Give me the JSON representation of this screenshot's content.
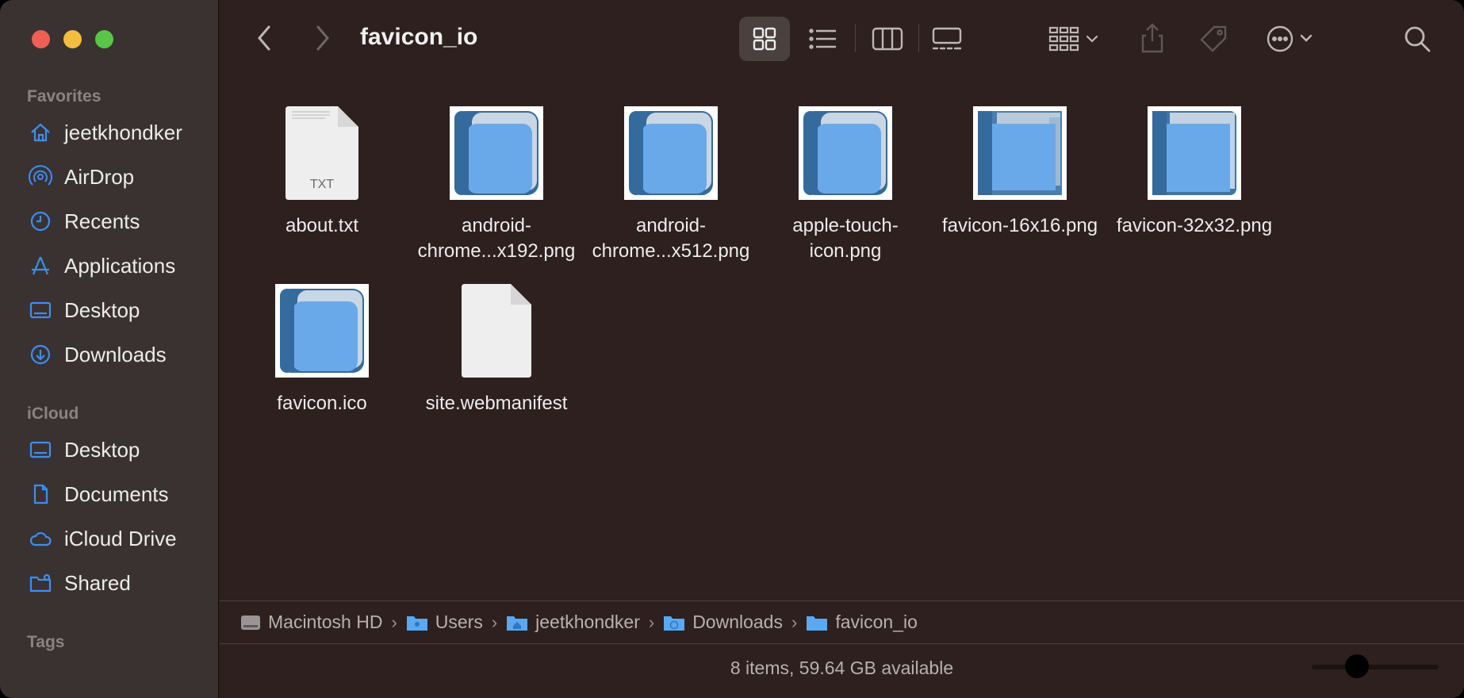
{
  "window": {
    "title": "favicon_io"
  },
  "toolbar": {
    "back_icon": "chevron-left",
    "forward_icon": "chevron-right",
    "views": [
      "icon-view",
      "list-view",
      "column-view",
      "gallery-view"
    ],
    "group_icon": "group-by",
    "share_icon": "share",
    "tag_icon": "tag",
    "more_icon": "ellipsis-circle",
    "search_icon": "magnifier"
  },
  "sidebar": {
    "favorites_title": "Favorites",
    "favorites": [
      {
        "label": "jeetkhondker",
        "icon": "home"
      },
      {
        "label": "AirDrop",
        "icon": "airdrop"
      },
      {
        "label": "Recents",
        "icon": "clock"
      },
      {
        "label": "Applications",
        "icon": "applications"
      },
      {
        "label": "Desktop",
        "icon": "desktop"
      },
      {
        "label": "Downloads",
        "icon": "download"
      }
    ],
    "icloud_title": "iCloud",
    "icloud": [
      {
        "label": "Desktop",
        "icon": "desktop"
      },
      {
        "label": "Documents",
        "icon": "document"
      },
      {
        "label": "iCloud Drive",
        "icon": "cloud"
      },
      {
        "label": "Shared",
        "icon": "shared-folder"
      }
    ],
    "tags_title": "Tags"
  },
  "files": [
    {
      "name": "about.txt",
      "kind": "txt",
      "badge": "TXT"
    },
    {
      "name": "android-chrome...x192.png",
      "kind": "png"
    },
    {
      "name": "android-chrome...x512.png",
      "kind": "png"
    },
    {
      "name": "apple-touch-icon.png",
      "kind": "png"
    },
    {
      "name": "favicon-16x16.png",
      "kind": "png"
    },
    {
      "name": "favicon-32x32.png",
      "kind": "png"
    },
    {
      "name": "favicon.ico",
      "kind": "png"
    },
    {
      "name": "site.webmanifest",
      "kind": "generic"
    }
  ],
  "pathbar": [
    {
      "label": "Macintosh HD",
      "icon": "disk"
    },
    {
      "label": "Users",
      "icon": "folder"
    },
    {
      "label": "jeetkhondker",
      "icon": "home-folder"
    },
    {
      "label": "Downloads",
      "icon": "download-folder"
    },
    {
      "label": "favicon_io",
      "icon": "folder"
    }
  ],
  "status": {
    "text": "8 items, 59.64 GB available"
  },
  "colors": {
    "accent": "#3b8ef6",
    "book": "#6aa9e9",
    "book_dark": "#356a9c"
  }
}
